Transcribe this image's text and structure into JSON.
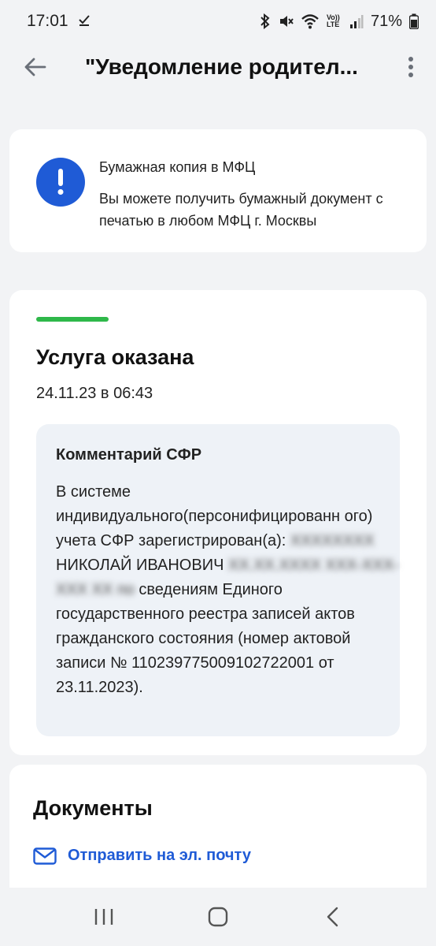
{
  "status_bar": {
    "time": "17:01",
    "volte_label": "Vo)) LTE",
    "battery": "71%"
  },
  "app_bar": {
    "title": "\"Уведомление родител...",
    "back_icon": "arrow-left-icon",
    "more_icon": "more-vertical-icon"
  },
  "notice": {
    "icon": "exclamation-icon",
    "title": "Бумажная копия в МФЦ",
    "text": "Вы можете получить бумажный документ с печатью в любом МФЦ г. Москвы",
    "accent_color": "#1f5bd6"
  },
  "status": {
    "title": "Услуга оказана",
    "date": "24.11.23 в 06:43",
    "indicator_color": "#2fb84a"
  },
  "comment": {
    "title": "Комментарий СФР",
    "text_part1": "В системе индивидуального(персонифицированн ого) учета СФР зарегистрирован(а): ",
    "blurred_name": "ХХХХХХХХ ",
    "name_visible": "НИКОЛАЙ ИВАНОВИЧ",
    "blurred_details": "ХХ.ХХ.ХХХХ ХХХ-ХХХ-ХХХ ХХ по",
    "text_part2": " сведениям Единого государственного реестра записей актов гражданского состояния (номер актовой записи № 110239775009102722001 от 23.11.2023)."
  },
  "documents": {
    "title": "Документы",
    "email_icon": "mail-icon",
    "email_label": "Отправить на эл. почту",
    "link_color": "#1f5bd6"
  },
  "nav": {
    "recents_icon": "recents-icon",
    "home_icon": "home-icon",
    "back_icon": "nav-back-icon"
  }
}
